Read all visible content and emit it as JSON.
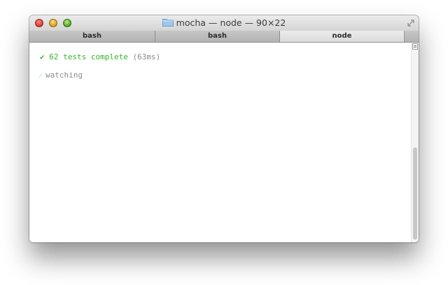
{
  "window": {
    "title": "mocha — node — 90×22"
  },
  "tabs": [
    {
      "label": "bash"
    },
    {
      "label": "bash"
    },
    {
      "label": "node"
    }
  ],
  "output": {
    "status_symbol": "✔",
    "status_text": "62 tests complete",
    "duration": "(63ms)",
    "spinner": "⁄",
    "watching": "watching"
  },
  "colors": {
    "success": "#35b52a",
    "muted": "#8a8a8a",
    "spinner": "#35b6c9"
  },
  "icons": {
    "folder": "folder-icon",
    "resize": "resize-icon",
    "scroll_menu": "scroll-menu-icon"
  }
}
